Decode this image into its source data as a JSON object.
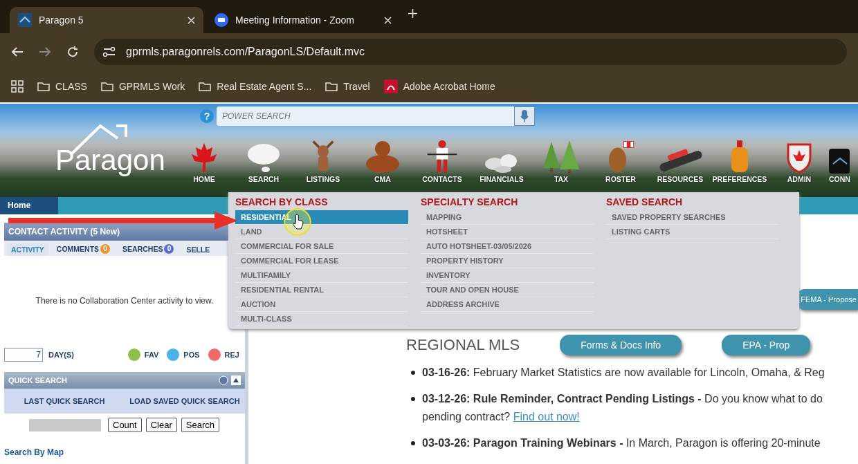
{
  "browser": {
    "tabs": [
      {
        "title": "Paragon 5",
        "selected": true,
        "kind": "paragon"
      },
      {
        "title": "Meeting Information - Zoom",
        "selected": false,
        "kind": "zoom"
      }
    ],
    "url": "gprmls.paragonrels.com/ParagonLS/Default.mvc",
    "bookmarks": [
      {
        "label": "CLASS",
        "kind": "folder"
      },
      {
        "label": "GPRMLS Work",
        "kind": "folder"
      },
      {
        "label": "Real Estate Agent S...",
        "kind": "folder"
      },
      {
        "label": "Travel",
        "kind": "folder"
      },
      {
        "label": "Adobe Acrobat Home",
        "kind": "pdf"
      }
    ]
  },
  "banner": {
    "logo": "Paragon",
    "help": "?",
    "power_search": {
      "placeholder": "POWER SEARCH"
    },
    "nav": [
      "HOME",
      "SEARCH",
      "LISTINGS",
      "CMA",
      "CONTACTS",
      "FINANCIALS",
      "TAX",
      "ROSTER",
      "RESOURCES",
      "PREFERENCES",
      "ADMIN",
      "CONN"
    ]
  },
  "home_tab": "Home",
  "left_panel": {
    "contact_activity": {
      "title": "CONTACT ACTIVITY (5 New)",
      "tabs": [
        {
          "label": "ACTIVITY",
          "selected": true
        },
        {
          "label": "COMMENTS",
          "count": "0",
          "color": "#f0932b",
          "selected": false
        },
        {
          "label": "SEARCHES",
          "count": "0",
          "color": "#5b6fd6",
          "selected": false
        },
        {
          "label": "SELLE",
          "selected": false
        }
      ],
      "empty_message": "There is no Collaboration Center activity to view."
    },
    "days": {
      "value": "7",
      "label": "DAY(S)"
    },
    "legend": [
      {
        "label": "FAV",
        "color": "#8cc04a"
      },
      {
        "label": "POS",
        "color": "#4ab3e8"
      },
      {
        "label": "REJ",
        "color": "#f06a6a"
      }
    ],
    "quick_search": {
      "title": "QUICK SEARCH",
      "options": [
        "LAST QUICK SEARCH",
        "LOAD SAVED QUICK SEARCH"
      ],
      "actions": [
        "Count",
        "Clear",
        "Search"
      ]
    },
    "link": "Search By Map"
  },
  "main": {
    "top_buttons": [
      "FEMA - Propose"
    ],
    "heading": "REGIONAL MLS",
    "buttons": [
      "Forms & Docs Info",
      "EPA - Prop"
    ],
    "news": [
      {
        "date": "03-16-26:",
        "text": "February Market Statistics are now available for Lincoln, Omaha, & Reg"
      },
      {
        "date": "03-12-26:",
        "title": "Rule Reminder, Contract Pending Listings -",
        "text": "Do you know what to do",
        "text2": "pending contract?",
        "link": "Find out now!"
      },
      {
        "date": "03-03-26:",
        "title": "Paragon Training Webinars -",
        "text": "In March, Paragon is offering 20-minute"
      }
    ]
  },
  "dropdown": {
    "columns": [
      {
        "heading": "SEARCH BY CLASS",
        "items": [
          {
            "label": "RESIDENTIAL",
            "selected": true
          },
          {
            "label": "LAND",
            "selected": false
          },
          {
            "label": "COMMERCIAL FOR SALE",
            "selected": false
          },
          {
            "label": "COMMERCIAL FOR LEASE",
            "selected": false
          },
          {
            "label": "MULTIFAMILY",
            "selected": false
          },
          {
            "label": "RESIDENTIAL RENTAL",
            "selected": false
          },
          {
            "label": "AUCTION",
            "selected": false
          },
          {
            "label": "MULTI-CLASS",
            "selected": false
          }
        ]
      },
      {
        "heading": "SPECIALTY SEARCH",
        "items": [
          {
            "label": "MAPPING",
            "selected": false
          },
          {
            "label": "HOTSHEET",
            "selected": false
          },
          {
            "label": "AUTO HOTSHEET-03/05/2026",
            "selected": false
          },
          {
            "label": "PROPERTY HISTORY",
            "selected": false
          },
          {
            "label": "INVENTORY",
            "selected": false
          },
          {
            "label": "TOUR AND OPEN HOUSE",
            "selected": false
          },
          {
            "label": "ADDRESS ARCHIVE",
            "selected": false
          }
        ]
      },
      {
        "heading": "SAVED SEARCH",
        "items": [
          {
            "label": "SAVED PROPERTY SEARCHES",
            "selected": false
          },
          {
            "label": "LISTING CARTS",
            "selected": false
          }
        ]
      }
    ]
  }
}
